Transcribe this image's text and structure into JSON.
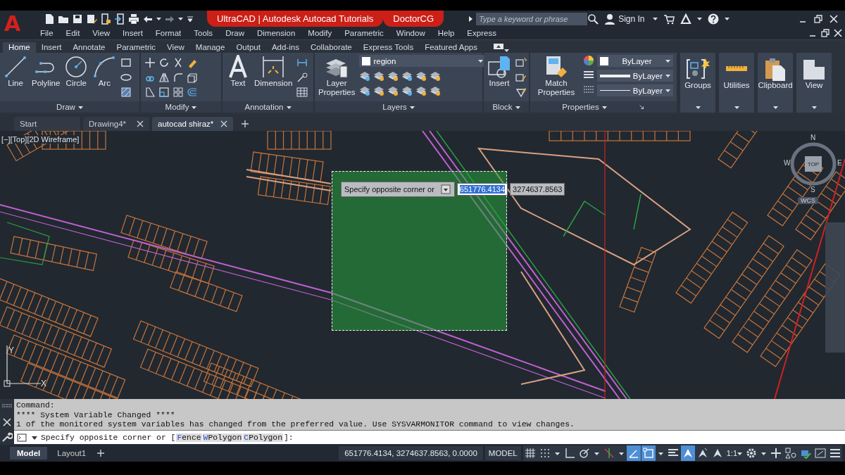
{
  "app": {
    "logo": "A"
  },
  "title_bar": {
    "banners": [
      "UltraCAD | Autodesk Autocad Tutorials",
      "DoctorCG"
    ],
    "search": {
      "placeholder": "Type a keyword or phrase"
    },
    "sign_in": "Sign In"
  },
  "menu_bar": [
    "File",
    "Edit",
    "View",
    "Insert",
    "Format",
    "Tools",
    "Draw",
    "Dimension",
    "Modify",
    "Parametric",
    "Window",
    "Help",
    "Express"
  ],
  "ribbon_tabs": [
    {
      "label": "Home",
      "selected": true
    },
    {
      "label": "Insert",
      "selected": false
    },
    {
      "label": "Annotate",
      "selected": false
    },
    {
      "label": "Parametric",
      "selected": false
    },
    {
      "label": "View",
      "selected": false
    },
    {
      "label": "Manage",
      "selected": false
    },
    {
      "label": "Output",
      "selected": false
    },
    {
      "label": "Add-ins",
      "selected": false
    },
    {
      "label": "Collaborate",
      "selected": false
    },
    {
      "label": "Express Tools",
      "selected": false
    },
    {
      "label": "Featured Apps",
      "selected": false
    }
  ],
  "ribbon_panels": [
    {
      "kind": "draw",
      "title": "Draw",
      "tools": [
        {
          "kind": "line",
          "label": "Line"
        },
        {
          "kind": "polyline",
          "label": "Polyline"
        },
        {
          "kind": "circle",
          "label": "Circle"
        },
        {
          "kind": "arc",
          "label": "Arc"
        }
      ]
    },
    {
      "kind": "modify",
      "title": "Modify"
    },
    {
      "kind": "annotation",
      "title": "Annotation",
      "tools": [
        {
          "kind": "text",
          "label": "Text"
        },
        {
          "kind": "dimension",
          "label": "Dimension"
        }
      ]
    },
    {
      "kind": "layers",
      "title": "Layers",
      "layer": "region",
      "tools": [
        {
          "kind": "layer-properties",
          "label": "Layer Properties"
        }
      ]
    },
    {
      "kind": "block",
      "title": "Block",
      "tools": [
        {
          "kind": "insert",
          "label": "Insert"
        }
      ]
    },
    {
      "kind": "properties",
      "title": "Properties",
      "dropdowns": [
        "ByLayer",
        "ByLayer",
        "ByLayer"
      ],
      "tools": [
        {
          "kind": "match-properties",
          "label": "Match Properties"
        }
      ]
    },
    {
      "kind": "collapsed",
      "tools": [
        {
          "kind": "groups",
          "label": "Groups"
        }
      ]
    },
    {
      "kind": "collapsed",
      "tools": [
        {
          "kind": "utilities",
          "label": "Utilities"
        }
      ]
    },
    {
      "kind": "collapsed",
      "tools": [
        {
          "kind": "clipboard",
          "label": "Clipboard"
        }
      ]
    },
    {
      "kind": "collapsed",
      "tools": [
        {
          "kind": "view",
          "label": "View"
        }
      ]
    }
  ],
  "doc_tabs": [
    {
      "label": "Start",
      "closable": false,
      "selected": false
    },
    {
      "label": "Drawing4*",
      "closable": true,
      "selected": false
    },
    {
      "label": "autocad shiraz*",
      "closable": true,
      "selected": true
    }
  ],
  "viewport": {
    "label": "[−][Top][2D Wireframe]",
    "tooltip": {
      "prompt": "Specify opposite corner or",
      "fields": [
        {
          "value": "651776.4134",
          "selected": true
        },
        {
          "value": "3274637.8563",
          "selected": false
        }
      ]
    },
    "viewcube": {
      "top": "TOP",
      "directions": [
        "N",
        "W",
        "E",
        "S"
      ],
      "coords": "WCS"
    },
    "ucs": {
      "x": "X",
      "y": "Y"
    }
  },
  "command_line": {
    "history": [
      "Command:",
      "**** System Variable Changed ****",
      "1 of the monitored system variables has changed from the preferred value. Use SYSVARMONITOR command to view changes."
    ],
    "prompt": "Specify opposite corner or [",
    "options": [
      {
        "key": "F",
        "rest": "ence"
      },
      {
        "key": "W",
        "rest": "Polygon"
      },
      {
        "key": "C",
        "rest": "Polygon"
      }
    ],
    "prompt_end": "]:"
  },
  "layout_tabs": [
    {
      "label": "Model",
      "selected": true
    },
    {
      "label": "Layout1",
      "selected": false
    }
  ],
  "status_bar": {
    "coordinates": "651776.4134, 3274637.8563, 0.0000",
    "space": "MODEL",
    "toggles": [
      {
        "kind": "grid",
        "on": false,
        "has_menu": false
      },
      {
        "kind": "snap",
        "on": false,
        "has_menu": true
      },
      {
        "kind": "ortho",
        "on": false,
        "has_menu": false
      },
      {
        "kind": "polar",
        "on": false,
        "has_menu": true
      },
      {
        "kind": "isodraft",
        "on": false,
        "has_menu": true
      },
      {
        "kind": "dynamic-input",
        "on": true,
        "has_menu": false
      },
      {
        "kind": "object-snap",
        "on": true,
        "has_menu": true
      },
      {
        "kind": "lineweight",
        "on": false,
        "has_menu": false
      },
      {
        "kind": "annotation-visibility",
        "on": true,
        "has_menu": false
      },
      {
        "kind": "autoscale",
        "on": false,
        "has_menu": false
      },
      {
        "kind": "annotation-scale",
        "on": false,
        "has_menu": false
      },
      {
        "kind": "scale",
        "label": "1:1",
        "on": false,
        "has_menu": true
      },
      {
        "kind": "settings",
        "on": false,
        "has_menu": true
      },
      {
        "kind": "plus",
        "on": false,
        "has_menu": false
      },
      {
        "kind": "isolate",
        "on": false,
        "has_menu": false
      },
      {
        "kind": "performance",
        "on": false,
        "has_menu": false
      },
      {
        "kind": "fullscreen",
        "on": false,
        "has_menu": false
      },
      {
        "kind": "menu",
        "on": false,
        "has_menu": false
      }
    ]
  }
}
